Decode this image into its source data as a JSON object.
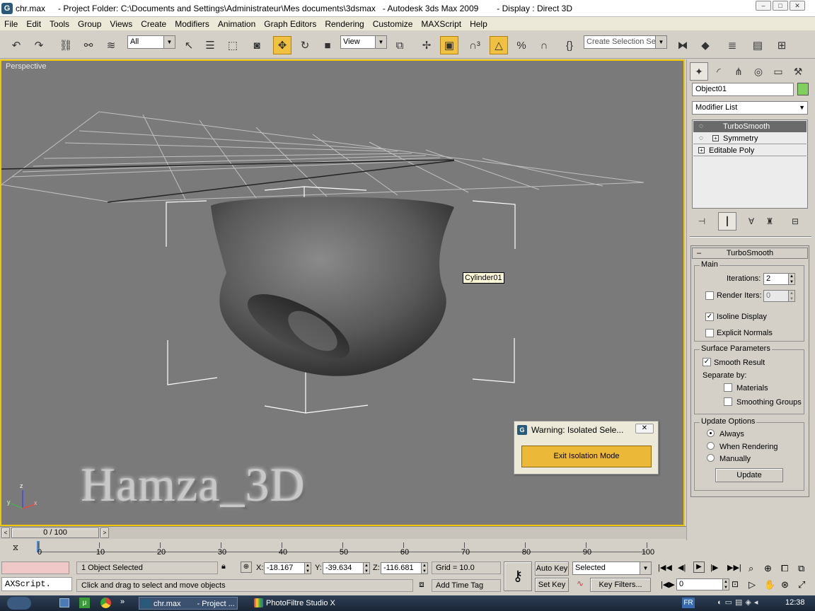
{
  "window": {
    "file": "chr.max",
    "folder": "- Project Folder: C:\\Documents and Settings\\Administrateur\\Mes documents\\3dsmax",
    "app": "- Autodesk 3ds Max  2009",
    "display": "- Display : Direct 3D"
  },
  "menu": [
    "File",
    "Edit",
    "Tools",
    "Group",
    "Views",
    "Create",
    "Modifiers",
    "Animation",
    "Graph Editors",
    "Rendering",
    "Customize",
    "MAXScript",
    "Help"
  ],
  "toolbar": {
    "filter": "All",
    "coord": "View",
    "selection_set": "Create Selection Se"
  },
  "viewport": {
    "label": "Perspective",
    "object_tip": "Cylinder01",
    "watermark": "Hamza_3D",
    "axis_x": "x",
    "axis_y": "y",
    "axis_z": "z"
  },
  "warning": {
    "title": "Warning: Isolated Sele...",
    "button": "Exit Isolation Mode"
  },
  "panel": {
    "object_name": "Object01",
    "object_color": "#80d060",
    "modifier_list": "Modifier List",
    "stack": [
      "TurboSmooth",
      "Symmetry",
      "Editable Poly"
    ],
    "rollout_title": "TurboSmooth",
    "main": "Main",
    "iterations_label": "Iterations:",
    "iterations": "2",
    "render_iters_label": "Render Iters:",
    "render_iters": "0",
    "isoline": "Isoline Display",
    "explicit": "Explicit Normals",
    "surface": "Surface Parameters",
    "smooth_result": "Smooth Result",
    "separate_by": "Separate by:",
    "materials": "Materials",
    "smoothing_groups": "Smoothing Groups",
    "update_options": "Update Options",
    "always": "Always",
    "when_rendering": "When Rendering",
    "manually": "Manually",
    "update_button": "Update"
  },
  "timeline": {
    "frame": "0 / 100",
    "ticks": [
      "0",
      "10",
      "20",
      "30",
      "40",
      "50",
      "60",
      "70",
      "80",
      "90",
      "100"
    ]
  },
  "status": {
    "maxscript": "AXScript.",
    "selected": "1 Object Selected",
    "prompt": "Click and drag to select and move objects",
    "x_label": "X:",
    "x": "-18.167",
    "y_label": "Y:",
    "y": "-39.634",
    "z_label": "Z:",
    "z": "-116.681",
    "grid": "Grid = 10.0",
    "add_time_tag": "Add Time Tag",
    "auto_key": "Auto Key",
    "set_key": "Set Key",
    "selected_dd": "Selected",
    "key_filters": "Key Filters...",
    "frame_field": "0"
  },
  "taskbar": {
    "items": [
      "chr.max",
      "- Project ...",
      "PhotoFiltre Studio X"
    ],
    "lang": "FR",
    "clock": "12:38"
  }
}
